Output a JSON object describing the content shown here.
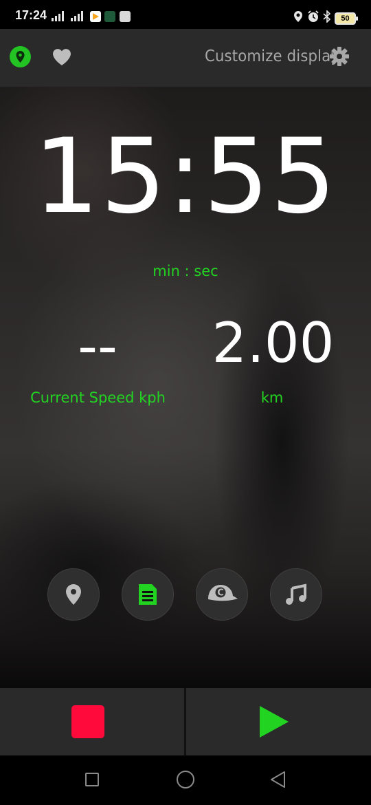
{
  "status_bar": {
    "time": "17:24",
    "battery": "50",
    "icons": [
      "signal-icon",
      "signal-icon",
      "play-store-icon",
      "run-app-icon",
      "app-icon",
      "location-icon",
      "alarm-icon",
      "bluetooth-icon",
      "battery-icon"
    ]
  },
  "app_bar": {
    "gps_icon": "location-pin-icon",
    "favorite_icon": "heart-icon",
    "customize_label": "Customize display",
    "settings_icon": "gear-icon"
  },
  "main": {
    "timer_value": "15:55",
    "timer_unit": "min : sec",
    "speed_value": "--",
    "speed_label": "Current Speed kph",
    "distance_value": "2.00",
    "distance_label": "km"
  },
  "action_buttons": [
    {
      "name": "map-button",
      "icon": "location-pin-icon"
    },
    {
      "name": "notes-button",
      "icon": "document-icon"
    },
    {
      "name": "coach-button",
      "icon": "cap-icon",
      "letter": "C"
    },
    {
      "name": "music-button",
      "icon": "music-note-icon"
    }
  ],
  "controls": {
    "stop_icon": "stop-icon",
    "play_icon": "play-icon"
  },
  "nav_bar": {
    "icons": [
      "recent-apps-icon",
      "home-icon",
      "back-icon"
    ]
  },
  "colors": {
    "accent_green": "#22d322",
    "stop_red": "#ff0a3a",
    "bar_bg": "#2a2a2a"
  }
}
